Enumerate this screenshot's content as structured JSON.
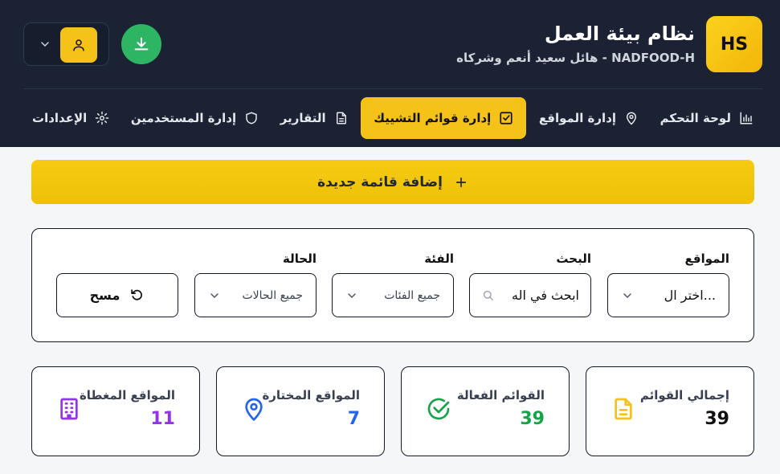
{
  "header": {
    "logo": "HS",
    "title": "نظام بيئة العمل",
    "subtitle": "NADFOOD-H - هائل سعيد أنعم وشركاه"
  },
  "nav": [
    {
      "label": "لوحة التحكم",
      "icon": "bar-chart-icon",
      "active": false
    },
    {
      "label": "إدارة المواقع",
      "icon": "map-pin-icon",
      "active": false
    },
    {
      "label": "إدارة قوائم التشييك",
      "icon": "checkbox-icon",
      "active": true
    },
    {
      "label": "التقارير",
      "icon": "file-text-icon",
      "active": false
    },
    {
      "label": "إدارة المستخدمين",
      "icon": "shield-icon",
      "active": false
    },
    {
      "label": "الإعدادات",
      "icon": "gear-icon",
      "active": false
    }
  ],
  "add_button": {
    "label": "إضافة قائمة جديدة",
    "icon": "plus-icon"
  },
  "filters": {
    "sites": {
      "label": "المواقع",
      "value": "اختر ال..."
    },
    "search": {
      "label": "البحث",
      "placeholder": "ابحث في اله"
    },
    "category": {
      "label": "الفئة",
      "value": "جميع الفئات"
    },
    "status": {
      "label": "الحالة",
      "value": "جميع الحالات"
    },
    "clear": {
      "label": "مسح",
      "icon": "rotate-ccw-icon"
    }
  },
  "stats": [
    {
      "label": "إجمالي القوائم",
      "value": "39",
      "color": "#111111",
      "icon": "file-icon",
      "icon_color": "#f5c21a"
    },
    {
      "label": "القوائم الفعالة",
      "value": "39",
      "color": "#16a34a",
      "icon": "check-circle-icon",
      "icon_color": "#16a34a"
    },
    {
      "label": "المواقع المختارة",
      "value": "7",
      "color": "#2563eb",
      "icon": "map-pin-icon",
      "icon_color": "#2563eb"
    },
    {
      "label": "المواقع المغطاة",
      "value": "11",
      "color": "#9333ea",
      "icon": "building-icon",
      "icon_color": "#9333ea"
    }
  ]
}
